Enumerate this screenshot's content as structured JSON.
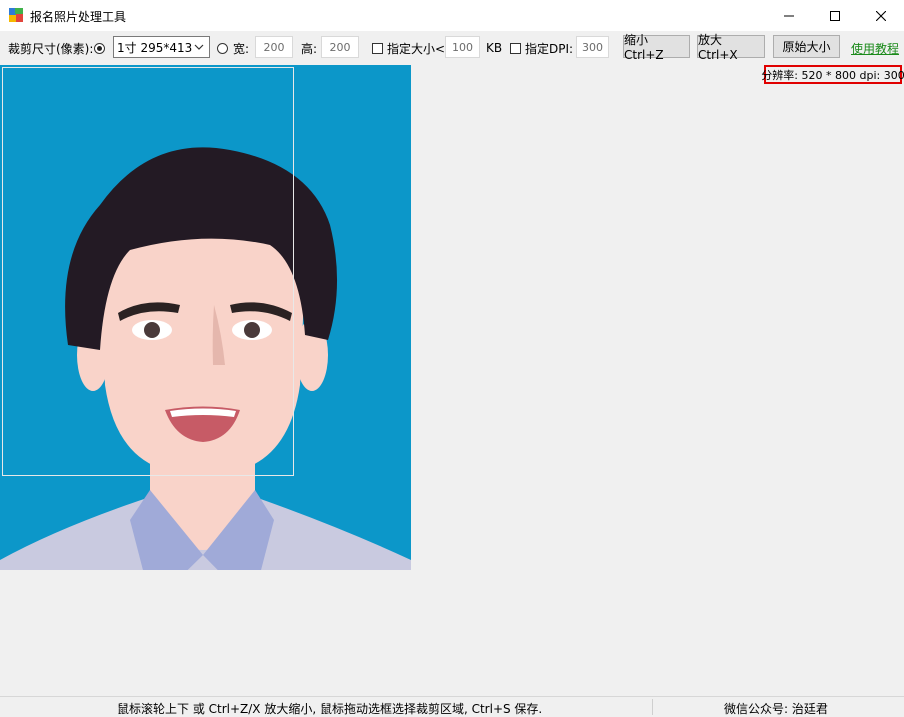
{
  "window": {
    "title": "报名照片处理工具",
    "controls": {
      "minimize": "minimize",
      "maximize": "maximize",
      "close": "close"
    }
  },
  "toolbar": {
    "crop_size_label": "裁剪尺寸(像素):",
    "preset_selected": "1寸  295*413",
    "width_label": "宽:",
    "width_value": "200",
    "height_label": "高:",
    "height_value": "200",
    "size_limit_label": "指定大小<",
    "size_limit_value": "100",
    "size_unit": "KB",
    "dpi_label": "指定DPI:",
    "dpi_value": "300",
    "zoom_out_label": "缩小 Ctrl+Z",
    "zoom_in_label": "放大 Ctrl+X",
    "original_size_label": "原始大小",
    "tutorial_link": "使用教程"
  },
  "canvas": {
    "resolution_info": "分辨率: 520 * 800 dpi: 300",
    "colors": {
      "background": "#0c97c9",
      "hair": "#231a24",
      "skin": "#f9d3c9",
      "shirt": "#c9cae0",
      "collar": "#a0aad8"
    }
  },
  "status": {
    "hint": "鼠标滚轮上下 或 Ctrl+Z/X 放大缩小, 鼠标拖动选框选择裁剪区域, Ctrl+S 保存.",
    "wechat": "微信公众号: 治廷君"
  }
}
